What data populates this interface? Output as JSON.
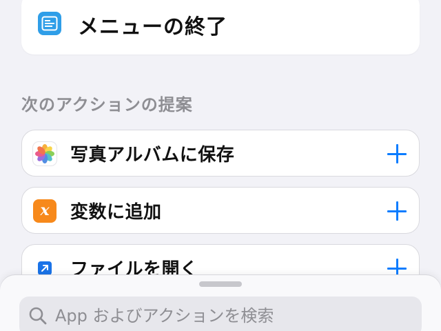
{
  "previous_action": {
    "label": "メニューの終了",
    "icon": "menu-list-icon",
    "icon_color": "#2f9ee8"
  },
  "suggestions": {
    "header": "次のアクションの提案",
    "items": [
      {
        "label": "写真アルバムに保存",
        "icon": "photos-icon"
      },
      {
        "label": "変数に追加",
        "icon": "variable-icon",
        "icon_color": "#f7891b",
        "icon_glyph": "x"
      },
      {
        "label": "ファイルを開く",
        "icon": "open-arrow-icon",
        "icon_color": "#1a73e8"
      }
    ],
    "add_icon": "plus-icon",
    "accent_color": "#0a7cff"
  },
  "search": {
    "placeholder": "App およびアクションを検索",
    "value": "",
    "icon": "search-icon"
  }
}
